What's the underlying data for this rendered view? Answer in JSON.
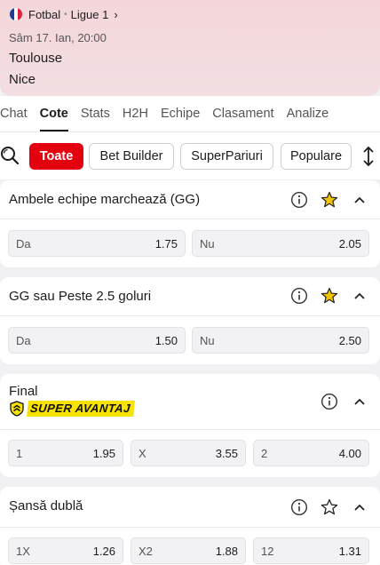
{
  "header": {
    "sport": "Fotbal",
    "league": "Ligue 1",
    "date": "Sâm 17. Ian, 20:00",
    "home_team": "Toulouse",
    "away_team": "Nice"
  },
  "tabs": [
    {
      "label": "Chat"
    },
    {
      "label": "Cote"
    },
    {
      "label": "Stats"
    },
    {
      "label": "H2H"
    },
    {
      "label": "Echipe"
    },
    {
      "label": "Clasament"
    },
    {
      "label": "Analize"
    }
  ],
  "filters": [
    {
      "label": "Toate"
    },
    {
      "label": "Bet Builder"
    },
    {
      "label": "SuperPariuri"
    },
    {
      "label": "Populare"
    }
  ],
  "markets": [
    {
      "title": "Ambele echipe marchează (GG)",
      "favorite": true,
      "odds": [
        {
          "label": "Da",
          "value": "1.75"
        },
        {
          "label": "Nu",
          "value": "2.05"
        }
      ]
    },
    {
      "title": "GG sau Peste 2.5 goluri",
      "favorite": true,
      "odds": [
        {
          "label": "Da",
          "value": "1.50"
        },
        {
          "label": "Nu",
          "value": "2.50"
        }
      ]
    },
    {
      "title": "Final",
      "badge": "SUPER AVANTAJ",
      "favorite": false,
      "odds": [
        {
          "label": "1",
          "value": "1.95"
        },
        {
          "label": "X",
          "value": "3.55"
        },
        {
          "label": "2",
          "value": "4.00"
        }
      ]
    },
    {
      "title": "Șansă dublă",
      "favorite": false,
      "odds": [
        {
          "label": "1X",
          "value": "1.26"
        },
        {
          "label": "X2",
          "value": "1.88"
        },
        {
          "label": "12",
          "value": "1.31"
        }
      ]
    }
  ],
  "colors": {
    "accent": "#e3000f",
    "star": "#f2c400",
    "badge": "#f7e200"
  }
}
